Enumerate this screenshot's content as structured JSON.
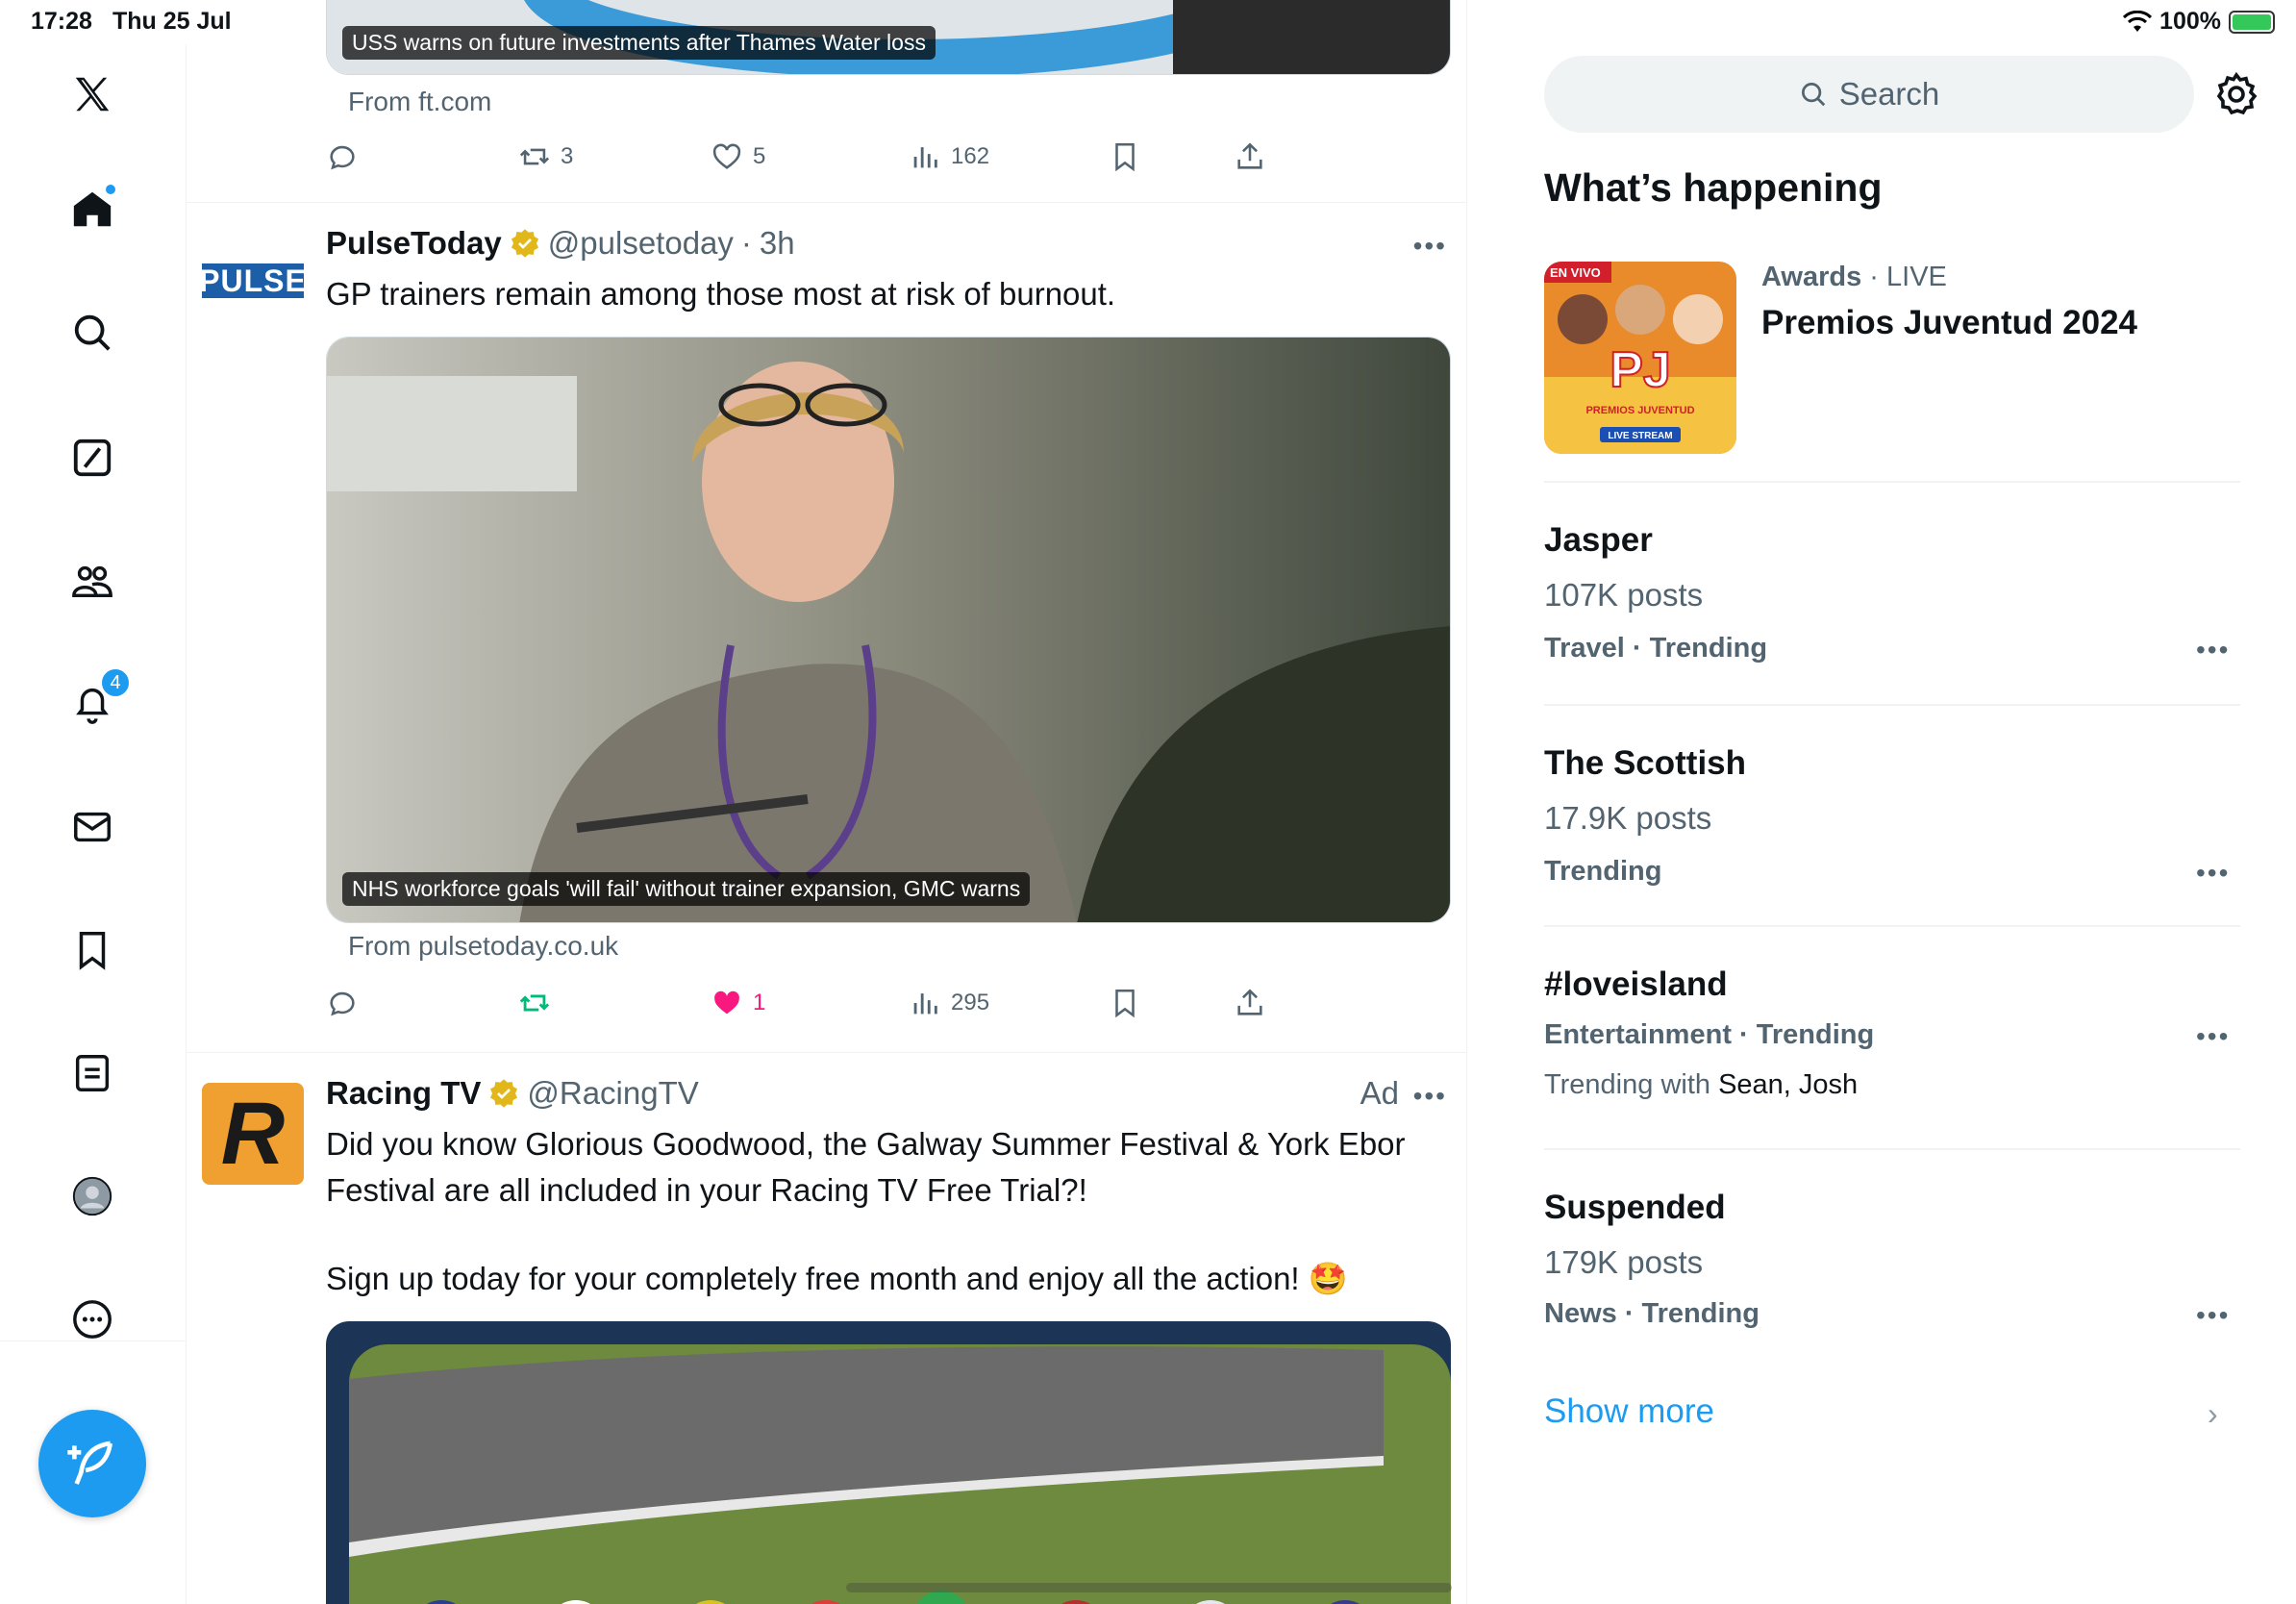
{
  "status_bar": {
    "time": "17:28",
    "date": "Thu 25 Jul",
    "battery": "100%"
  },
  "nav": {
    "notifications_badge": "4"
  },
  "feed": {
    "tweet1": {
      "caption": "USS warns on future investments after Thames Water loss",
      "from": "From ft.com",
      "retweets": "3",
      "likes": "5",
      "views": "162"
    },
    "tweet2": {
      "name": "PulseToday",
      "handle": "@pulsetoday",
      "time": "3h",
      "avatar_text": "PULSE",
      "text": "GP trainers remain among those most at risk of burnout.",
      "caption": "NHS workforce goals 'will fail' without trainer expansion, GMC warns",
      "from": "From pulsetoday.co.uk",
      "likes": "1",
      "views": "295"
    },
    "tweet3": {
      "name": "Racing TV",
      "handle": "@RacingTV",
      "ad_label": "Ad",
      "avatar_letter": "R",
      "text_line1": "Did you know Glorious Goodwood, the Galway Summer Festival & York Ebor Festival are all included in your Racing TV Free Trial?!",
      "text_line2": "Sign up today for your completely free month and enjoy all the action! 🤩"
    }
  },
  "sidebar": {
    "search_placeholder": "Search",
    "section_title": "What’s happening",
    "event": {
      "category": "Awards",
      "status": "LIVE",
      "title": "Premios Juventud 2024",
      "image_text_top": "EN VIVO",
      "image_text_logo": "PJ",
      "image_text_sub": "PREMIOS JUVENTUD",
      "image_text_stream": "LIVE STREAM"
    },
    "trends": [
      {
        "title": "Jasper",
        "posts": "107K posts",
        "meta": "Travel · Trending"
      },
      {
        "title": "The Scottish",
        "posts": "17.9K posts",
        "meta": "Trending"
      },
      {
        "title": "#loveisland",
        "meta": "Entertainment · Trending",
        "with_label": "Trending with",
        "with_names": "Sean, Josh"
      },
      {
        "title": "Suspended",
        "posts": "179K posts",
        "meta": "News · Trending"
      }
    ],
    "show_more": "Show more"
  },
  "colors": {
    "accent": "#1d9bf0",
    "like": "#f91880",
    "retweet": "#00ba7c",
    "verified": "#e2b719",
    "racing_orange": "#f0a030"
  }
}
